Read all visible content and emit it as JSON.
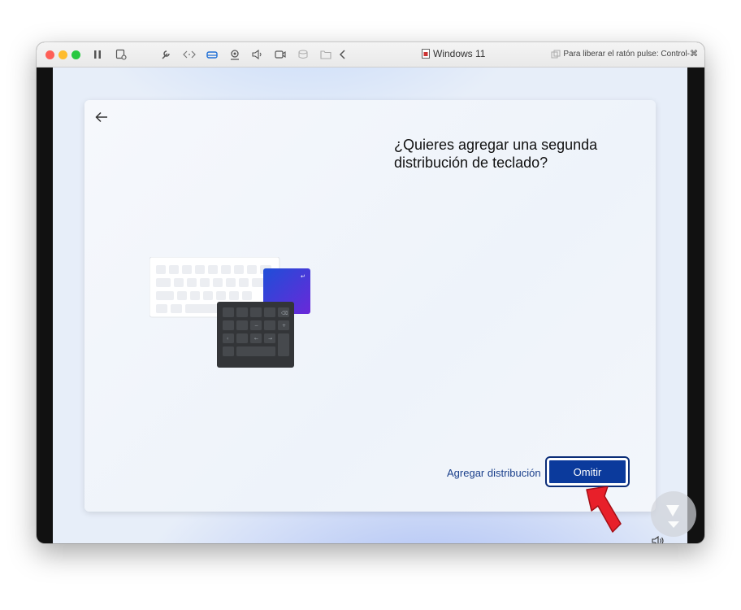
{
  "titlebar": {
    "window_title": "Windows 11",
    "release_hint": "Para liberar el ratón pulse: Control-⌘",
    "toolbar_icons": [
      "pause-icon",
      "settings-icon",
      "wrench-icon",
      "code-arrows-icon",
      "drive-icon",
      "camera-icon",
      "speaker-icon",
      "video-icon",
      "disk-icon",
      "folder-icon",
      "chevron-left-icon"
    ]
  },
  "setup": {
    "question_line1": "¿Quieres agregar una segunda",
    "question_line2": "distribución de teclado?",
    "add_layout_link": "Agregar distribución",
    "skip_button": "Omitir"
  },
  "colors": {
    "accent": "#0b3a9c",
    "link": "#1a3f8b",
    "arrow": "#e8202a"
  }
}
